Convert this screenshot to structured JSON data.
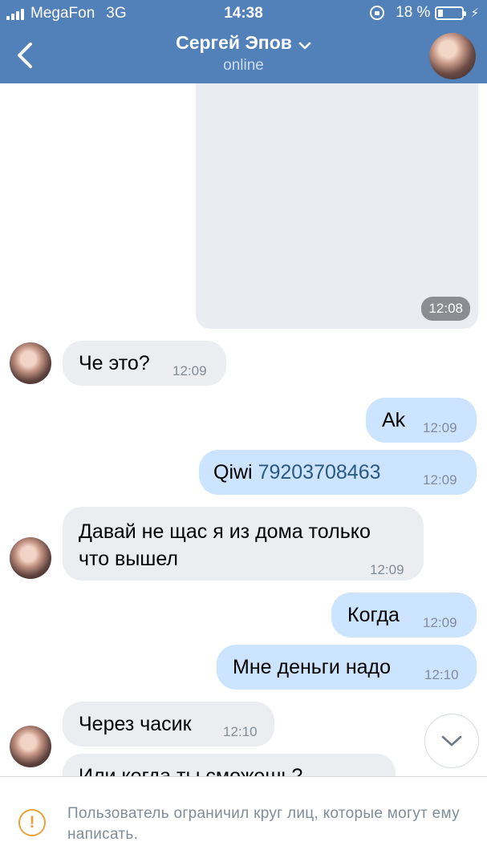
{
  "status_bar": {
    "carrier": "MegaFon",
    "network": "3G",
    "time": "14:38",
    "battery": "18 %"
  },
  "header": {
    "title": "Сергей Эпов",
    "status": "online"
  },
  "messages": [
    {
      "direction": "out",
      "type": "photo",
      "time": "12:08"
    },
    {
      "direction": "in",
      "text": "Че это?",
      "time": "12:09"
    },
    {
      "direction": "out",
      "text": "Ak",
      "time": "12:09"
    },
    {
      "direction": "out",
      "text_prefix": "Qiwi ",
      "phone": "79203708463",
      "time": "12:09"
    },
    {
      "direction": "in",
      "text_line1": "Давай не щас я из дома только",
      "text_line2": "что вышел",
      "time": "12:09"
    },
    {
      "direction": "out",
      "text": "Когда",
      "time": "12:09"
    },
    {
      "direction": "out",
      "text": "Мне деньги надо",
      "time": "12:10"
    },
    {
      "direction": "in",
      "text": "Через часик",
      "time": "12:10"
    },
    {
      "direction": "in",
      "text": "Или когда ты сможешь?",
      "time": ""
    }
  ],
  "footer": {
    "notice": "Пользователь ограничил круг лиц, которые могут ему написать."
  },
  "colors": {
    "header_bg": "#5181b8",
    "incoming_bubble": "#ebedf0",
    "outgoing_bubble": "#cce4ff",
    "link": "#2a5885",
    "warning": "#e6a23c"
  },
  "icons": [
    "signal-icon",
    "rotation-lock-icon",
    "battery-icon",
    "charging-icon",
    "back-icon",
    "chevron-down-icon",
    "warning-icon",
    "scroll-down-icon"
  ]
}
